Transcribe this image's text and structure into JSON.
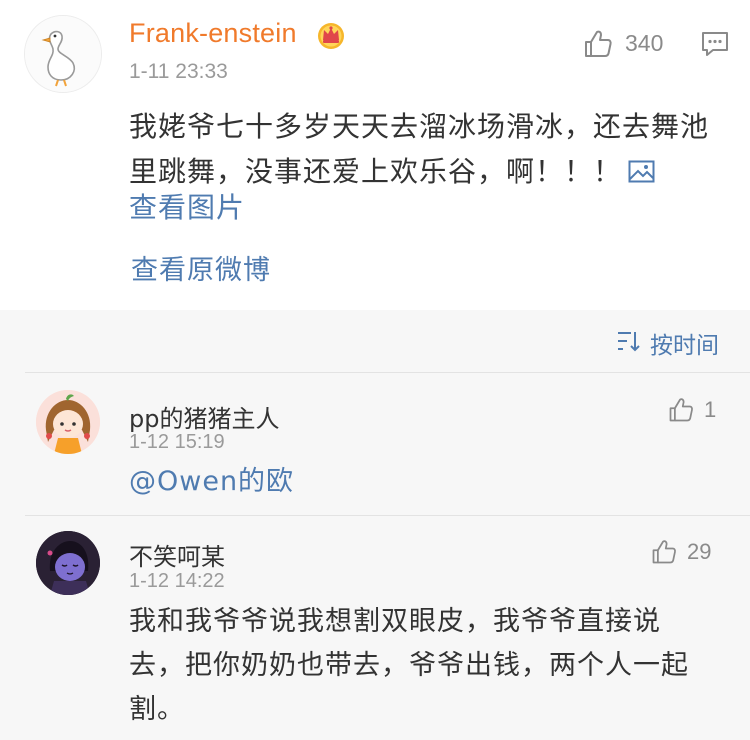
{
  "post": {
    "username": "Frank-enstein",
    "time": "1-11 23:33",
    "likes": "340",
    "text": "我姥爷七十多岁天天去溜冰场滑冰，还去舞池里跳舞，没事还爱上欢乐谷，啊！！！",
    "view_pics_label": "查看图片",
    "view_original_label": "查看原微博",
    "badge_icon": "crown-icon",
    "avatar_icon": "goose-avatar"
  },
  "sort": {
    "label": "按时间",
    "icon": "sort-icon"
  },
  "comments": [
    {
      "username": "pp的猪猪主人",
      "time": "1-12 15:19",
      "likes": "1",
      "text": "@Owen的欧"
    },
    {
      "username": "不笑呵某",
      "time": "1-12 14:22",
      "likes": "29",
      "text": "我和我爷爷说我想割双眼皮，我爷爷直接说去，把你奶奶也带去，爷爷出钱，两个人一起割。"
    }
  ],
  "colors": {
    "username_accent": "#f07a2b",
    "link_blue": "#4f7bb0",
    "comments_bg": "#f7f7f7",
    "meta_gray": "#9a9a9a"
  }
}
